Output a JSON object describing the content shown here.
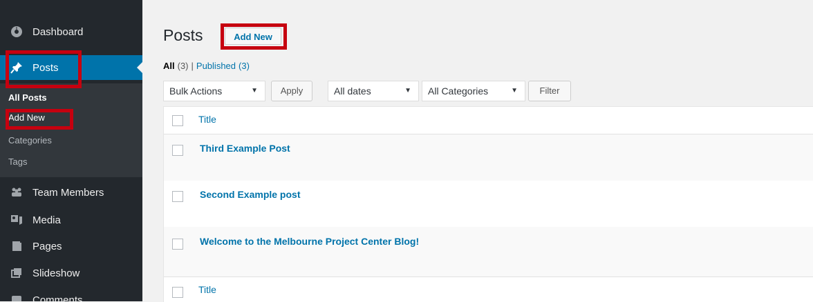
{
  "sidebar": {
    "items": [
      {
        "label": "Dashboard",
        "icon": "dashboard-icon"
      },
      {
        "label": "Posts",
        "icon": "pin-icon"
      },
      {
        "label": "Team Members",
        "icon": "group-icon"
      },
      {
        "label": "Media",
        "icon": "media-icon"
      },
      {
        "label": "Pages",
        "icon": "pages-icon"
      },
      {
        "label": "Slideshow",
        "icon": "slideshow-icon"
      },
      {
        "label": "Comments",
        "icon": "comments-icon"
      }
    ],
    "submenu": [
      {
        "label": "All Posts"
      },
      {
        "label": "Add New"
      },
      {
        "label": "Categories"
      },
      {
        "label": "Tags"
      }
    ]
  },
  "header": {
    "title": "Posts",
    "add_new": "Add New"
  },
  "filters": {
    "all_label": "All",
    "all_count": "(3)",
    "separator": "|",
    "published_label": "Published",
    "published_count": "(3)"
  },
  "toolbar": {
    "bulk_actions": "Bulk Actions",
    "apply": "Apply",
    "dates": "All dates",
    "categories": "All Categories",
    "filter": "Filter"
  },
  "table": {
    "header_title": "Title",
    "footer_title": "Title",
    "rows": [
      {
        "title": "Third Example Post"
      },
      {
        "title": "Second Example post"
      },
      {
        "title": "Welcome to the Melbourne Project Center Blog!"
      }
    ]
  },
  "colors": {
    "sidebar_bg": "#23282d",
    "active_bg": "#0073aa",
    "link": "#0073aa",
    "highlight": "#c6000f"
  }
}
